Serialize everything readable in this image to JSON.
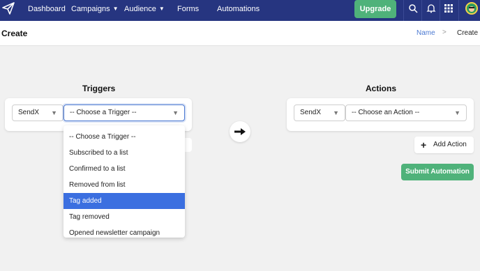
{
  "nav": {
    "items": [
      {
        "label": "Dashboard"
      },
      {
        "label": "Campaigns"
      },
      {
        "label": "Audience"
      },
      {
        "label": "Forms"
      },
      {
        "label": "Automations"
      }
    ],
    "upgrade_label": "Upgrade"
  },
  "header": {
    "title": "Create",
    "breadcrumb": {
      "link": "Name",
      "separator": ">",
      "current": "Create"
    }
  },
  "triggers": {
    "title": "Triggers",
    "source_value": "SendX",
    "trigger_value": "-- Choose a Trigger --",
    "options": [
      "-- Choose a Trigger --",
      "Subscribed to a list",
      "Confirmed to a list",
      "Removed from list",
      "Tag added",
      "Tag removed",
      "Opened newsletter campaign"
    ],
    "selected_index": 4
  },
  "actions": {
    "title": "Actions",
    "source_value": "SendX",
    "action_value": "-- Choose an Action --",
    "add_label": "Add Action",
    "add_icon": "+",
    "submit_label": "Submit Automation"
  },
  "colors": {
    "navbar": "#263580",
    "accent_green": "#4fb27a",
    "link_blue": "#4b79d2",
    "selected_blue": "#3b6fe0"
  },
  "icons": [
    "paper-plane-logo-icon",
    "chevron-down-icon",
    "search-icon",
    "bell-icon",
    "grid-icon",
    "avatar",
    "arrow-right-icon",
    "plus-icon"
  ]
}
